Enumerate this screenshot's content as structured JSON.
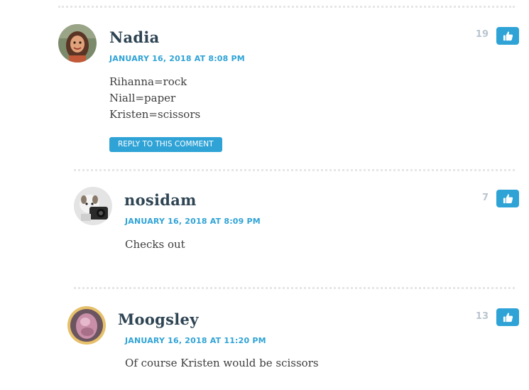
{
  "comments": [
    {
      "author": "Nadia",
      "date": "JANUARY 16, 2018 AT 8:08 PM",
      "lines": [
        "Rihanna=rock",
        "Niall=paper",
        "Kristen=scissors"
      ],
      "reply_label": "REPLY TO THIS COMMENT",
      "likes": "19",
      "avatar_icon": "avatar-photo-woman-icon"
    },
    {
      "author": "nosidam",
      "date": "JANUARY 16, 2018 AT 8:09 PM",
      "lines": [
        "Checks out"
      ],
      "likes": "7",
      "avatar_icon": "avatar-photo-dog-camera-icon"
    },
    {
      "author": "Moogsley",
      "date": "JANUARY 16, 2018 AT 11:20 PM",
      "lines": [
        "Of course Kristen would be scissors"
      ],
      "likes": "13",
      "avatar_icon": "avatar-photo-pink-icon"
    }
  ],
  "colors": {
    "accent": "#2fa3d6",
    "author": "#2e4453",
    "count": "#b9c6cf"
  },
  "like_icon": "thumbs-up-icon"
}
